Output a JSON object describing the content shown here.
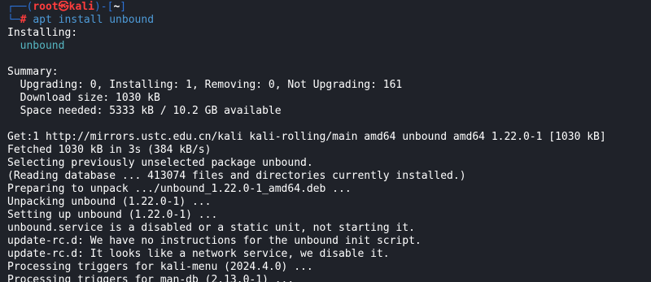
{
  "prompt": {
    "corner_top": "┌──(",
    "user": "root",
    "skull": "㉿",
    "host": "kali",
    "mid": ")-[",
    "cwd": "~",
    "end": "]",
    "corner_bottom": "└─",
    "hash": "#",
    "command": "apt install unbound"
  },
  "output": {
    "installing_label": "Installing:",
    "installing_pkg": "  unbound",
    "summary_label": "Summary:",
    "summary_line1": "  Upgrading: 0, Installing: 1, Removing: 0, Not Upgrading: 161",
    "summary_line2": "  Download size: 1030 kB",
    "summary_line3": "  Space needed: 5333 kB / 10.2 GB available",
    "log": [
      "Get:1 http://mirrors.ustc.edu.cn/kali kali-rolling/main amd64 unbound amd64 1.22.0-1 [1030 kB]",
      "Fetched 1030 kB in 3s (384 kB/s)",
      "Selecting previously unselected package unbound.",
      "(Reading database ... 413074 files and directories currently installed.)",
      "Preparing to unpack .../unbound_1.22.0-1_amd64.deb ...",
      "Unpacking unbound (1.22.0-1) ...",
      "Setting up unbound (1.22.0-1) ...",
      "unbound.service is a disabled or a static unit, not starting it.",
      "update-rc.d: We have no instructions for the unbound init script.",
      "update-rc.d: It looks like a network service, we disable it.",
      "Processing triggers for kali-menu (2024.4.0) ...",
      "Processing triggers for man-db (2.13.0-1) ..."
    ]
  },
  "colors": {
    "background": "#1f2229",
    "prompt_frame": "#2d73d8",
    "root_user": "#ff3d3d",
    "command": "#4e9bd8",
    "package": "#56b6c2",
    "text": "#ffffff"
  }
}
